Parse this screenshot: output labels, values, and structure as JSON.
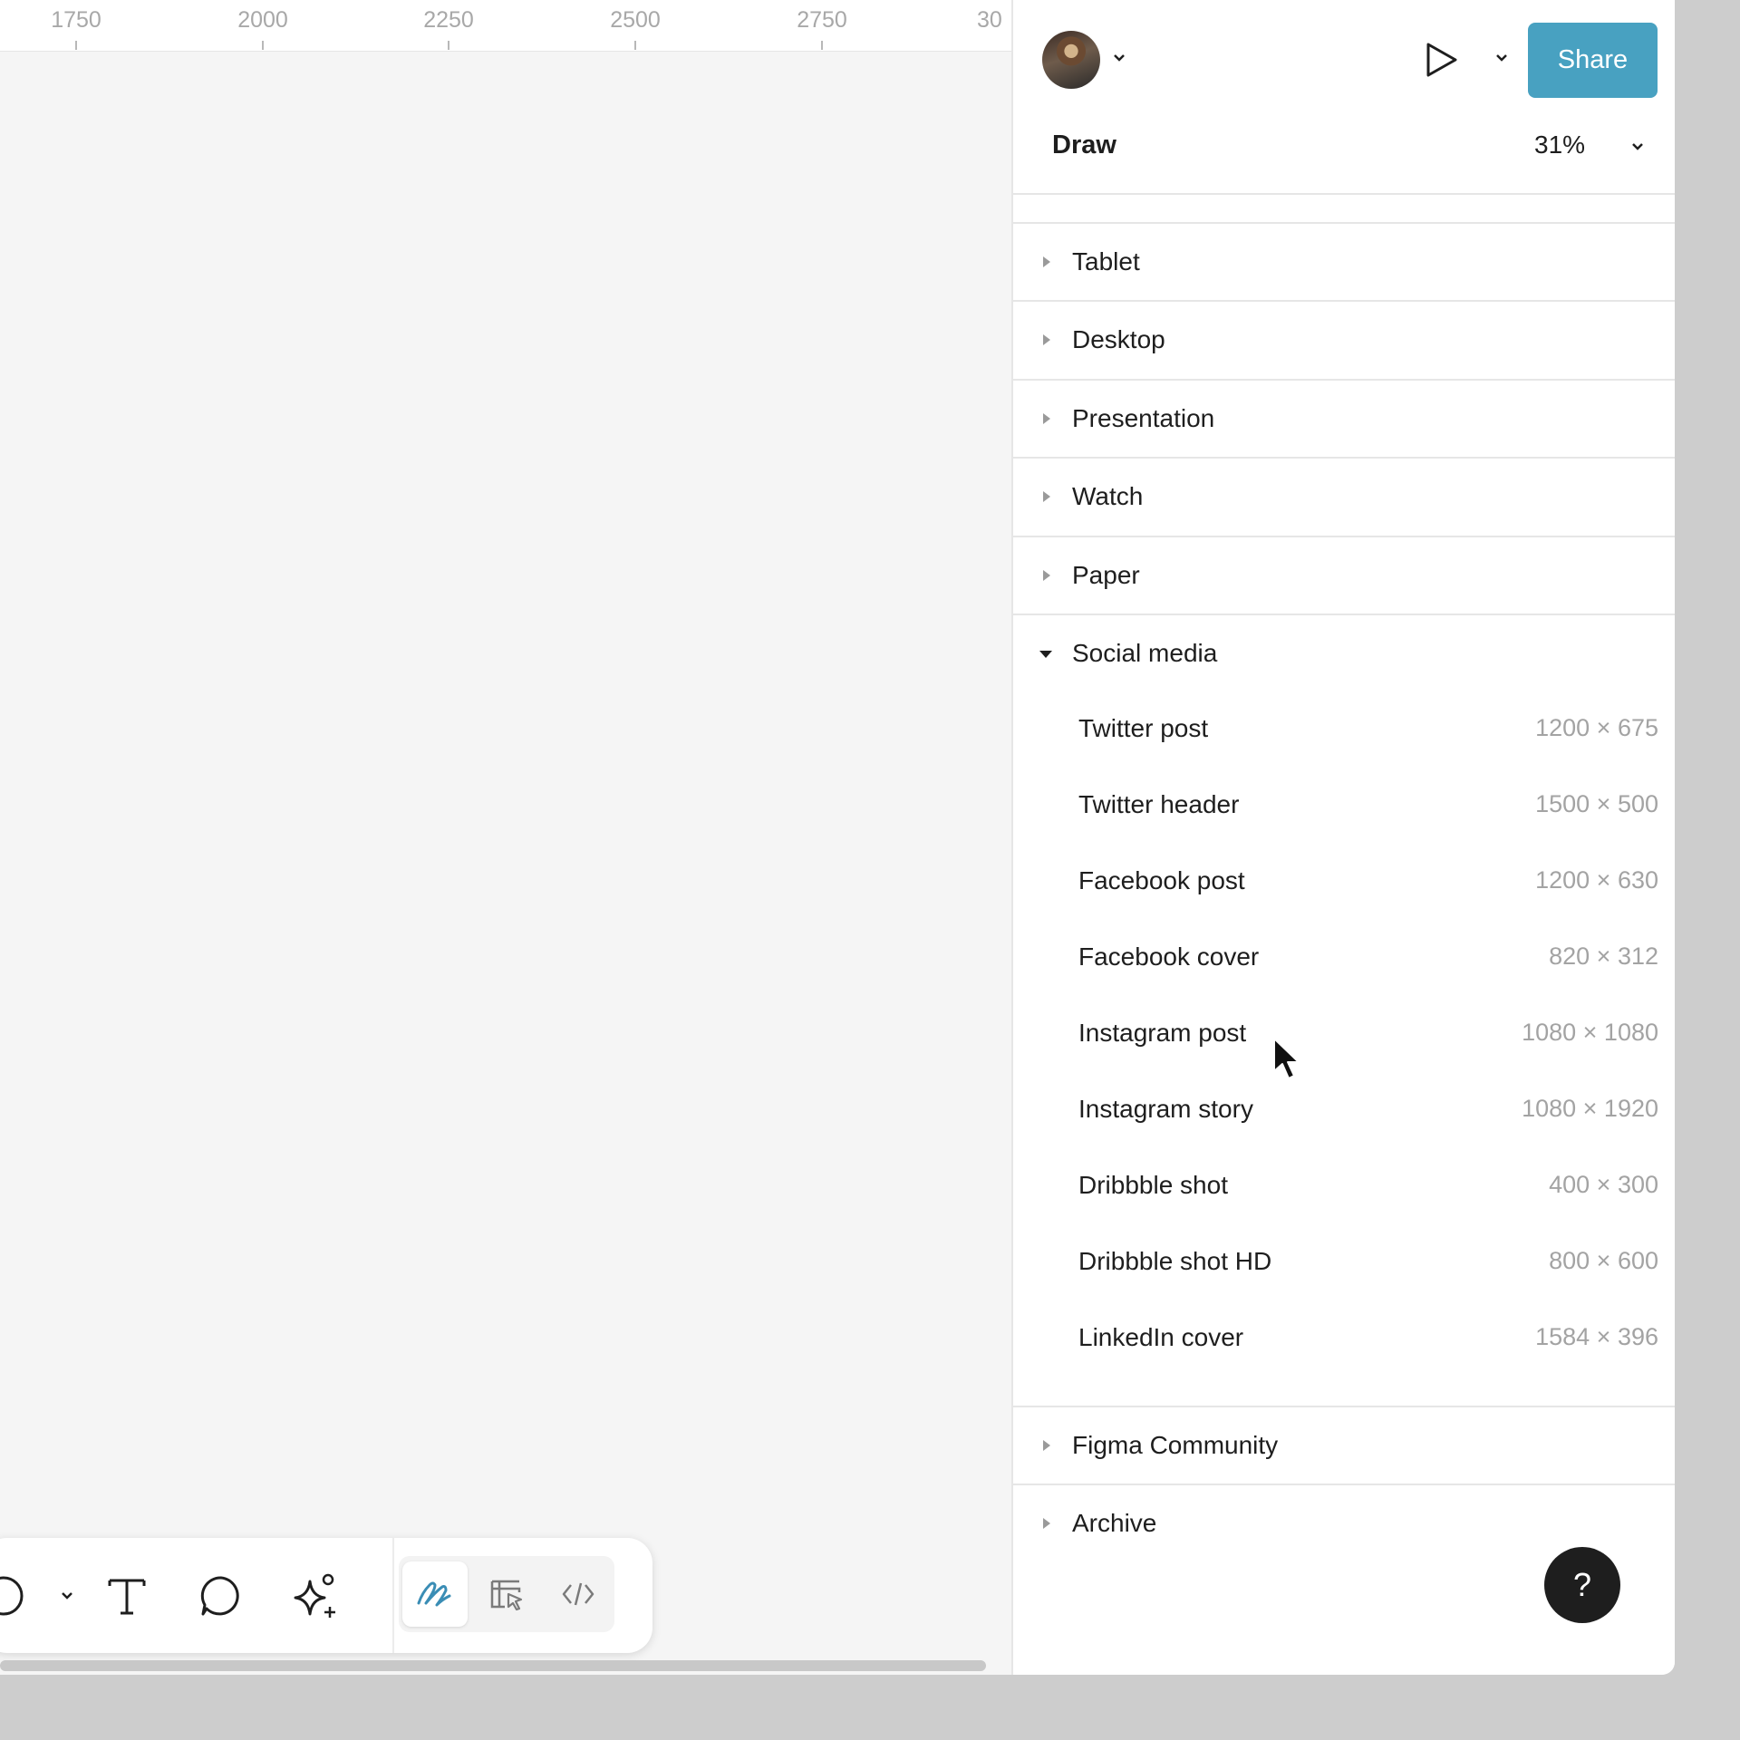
{
  "ruler": {
    "ticks": [
      "1750",
      "2000",
      "2250",
      "2500",
      "2750",
      "30"
    ]
  },
  "toolbar": {
    "tools": [
      "ellipse-icon",
      "chevron-down-icon",
      "text-icon",
      "comment-icon",
      "ai-sparkle-icon"
    ],
    "modes": [
      "draw-mode-icon",
      "design-mode-icon",
      "dev-mode-icon"
    ],
    "active_mode": "draw-mode-icon"
  },
  "header": {
    "share_label": "Share",
    "mode_label": "Draw",
    "zoom": "31%",
    "accent_color": "#48a1c1"
  },
  "sections": {
    "tablet": "Tablet",
    "desktop": "Desktop",
    "presentation": "Presentation",
    "watch": "Watch",
    "paper": "Paper",
    "social_media": "Social media",
    "figma_community": "Figma Community",
    "archive": "Archive"
  },
  "social_media_presets": [
    {
      "name": "Twitter post",
      "size": "1200 × 675"
    },
    {
      "name": "Twitter header",
      "size": "1500 × 500"
    },
    {
      "name": "Facebook post",
      "size": "1200 × 630"
    },
    {
      "name": "Facebook cover",
      "size": "820 × 312"
    },
    {
      "name": "Instagram post",
      "size": "1080 × 1080"
    },
    {
      "name": "Instagram story",
      "size": "1080 × 1920"
    },
    {
      "name": "Dribbble shot",
      "size": "400 × 300"
    },
    {
      "name": "Dribbble shot HD",
      "size": "800 × 600"
    },
    {
      "name": "LinkedIn cover",
      "size": "1584 × 396"
    }
  ],
  "help": {
    "label": "?"
  }
}
